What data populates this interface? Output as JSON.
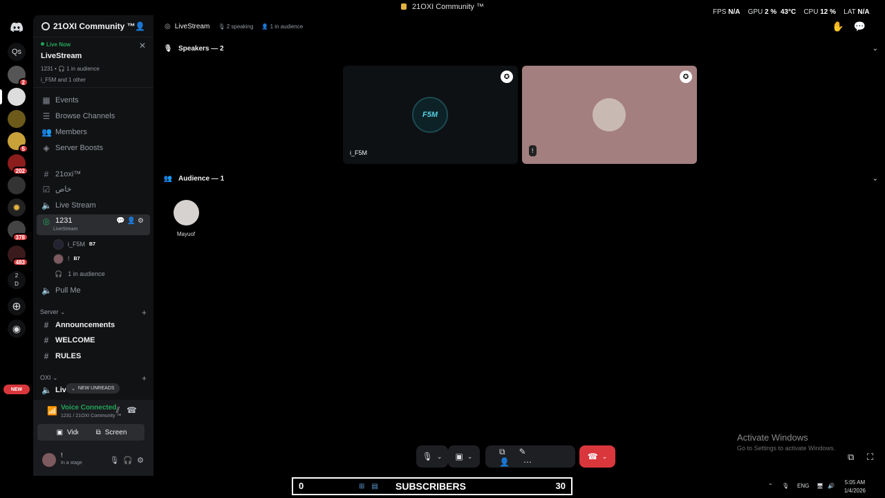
{
  "window": {
    "title": "21OXI Community ™"
  },
  "perf_overlay": {
    "fps_label": "FPS",
    "fps_value": "N/A",
    "gpu_label": "GPU",
    "gpu_value": "2 %",
    "gpu_temp": "43°C",
    "cpu_label": "CPU",
    "cpu_value": "12 %",
    "lat_label": "LAT",
    "lat_value": "N/A"
  },
  "rail": {
    "home_icon": "discord-logo-icon",
    "server_initials": "Qs",
    "badges": [
      "2",
      "5",
      "202",
      "378",
      "483"
    ],
    "folder_chars": [
      "2",
      "D"
    ],
    "new_label": "NEW",
    "add_icon": "plus-icon",
    "discover_icon": "compass-icon"
  },
  "sidebar": {
    "guild_name": "21OXI Community ™",
    "live_card": {
      "live_now": "Live Now",
      "title": "LiveStream",
      "meta": "1231 • 🎧 1 in audience",
      "speakers": "i_F5M and 1 other"
    },
    "nav_items": [
      {
        "label": "Events",
        "icon": "calendar-icon"
      },
      {
        "label": "Browse Channels",
        "icon": "list-icon"
      },
      {
        "label": "Members",
        "icon": "members-icon"
      },
      {
        "label": "Server Boosts",
        "icon": "boost-icon"
      }
    ],
    "channels": [
      {
        "label": "21oxi™",
        "icon": "hash-icon"
      },
      {
        "label": "خاص",
        "icon": "checkbox-icon"
      },
      {
        "label": "Live Stream",
        "icon": "speaker-icon"
      }
    ],
    "active_channel": {
      "label": "1231",
      "sublabel": "LiveStream",
      "icon": "stage-icon"
    },
    "voice_users": [
      {
        "name": "i_F5M",
        "tag": "B7"
      },
      {
        "name": "!",
        "tag": "B7"
      }
    ],
    "audience_count": "1 in audience",
    "pull_me": "Pull Me",
    "category_server": "Server",
    "server_channels": [
      "Announcements",
      "WELCOME",
      "RULES"
    ],
    "category_oxi": "OXI",
    "oxi_partial": "Live",
    "new_unreads": "NEW UNREADS"
  },
  "voicebar": {
    "status": "Voice Connected",
    "location": "1231 / 21OXI Community ™",
    "video_label": "Video",
    "screen_label": "Screen",
    "username": "!",
    "user_status": "In a stage"
  },
  "main": {
    "header_title": "LiveStream",
    "speaking": "2 speaking",
    "audience": "1 in audience",
    "speakers_section": "Speakers — 2",
    "audience_section": "Audience — 1",
    "tiles": [
      {
        "name": "i_F5M",
        "logo_text": "F5M"
      },
      {
        "name": "!"
      }
    ],
    "audience_members": [
      {
        "name": "Mayuof"
      }
    ]
  },
  "watermark": {
    "line1": "Activate Windows",
    "line2": "Go to Settings to activate Windows."
  },
  "taskbar": {
    "sub_count_left": "0",
    "sub_label": "SUBSCRIBERS",
    "sub_count_right": "30",
    "lang": "ENG",
    "time": "5:05 AM",
    "date": "1/4/2026"
  }
}
